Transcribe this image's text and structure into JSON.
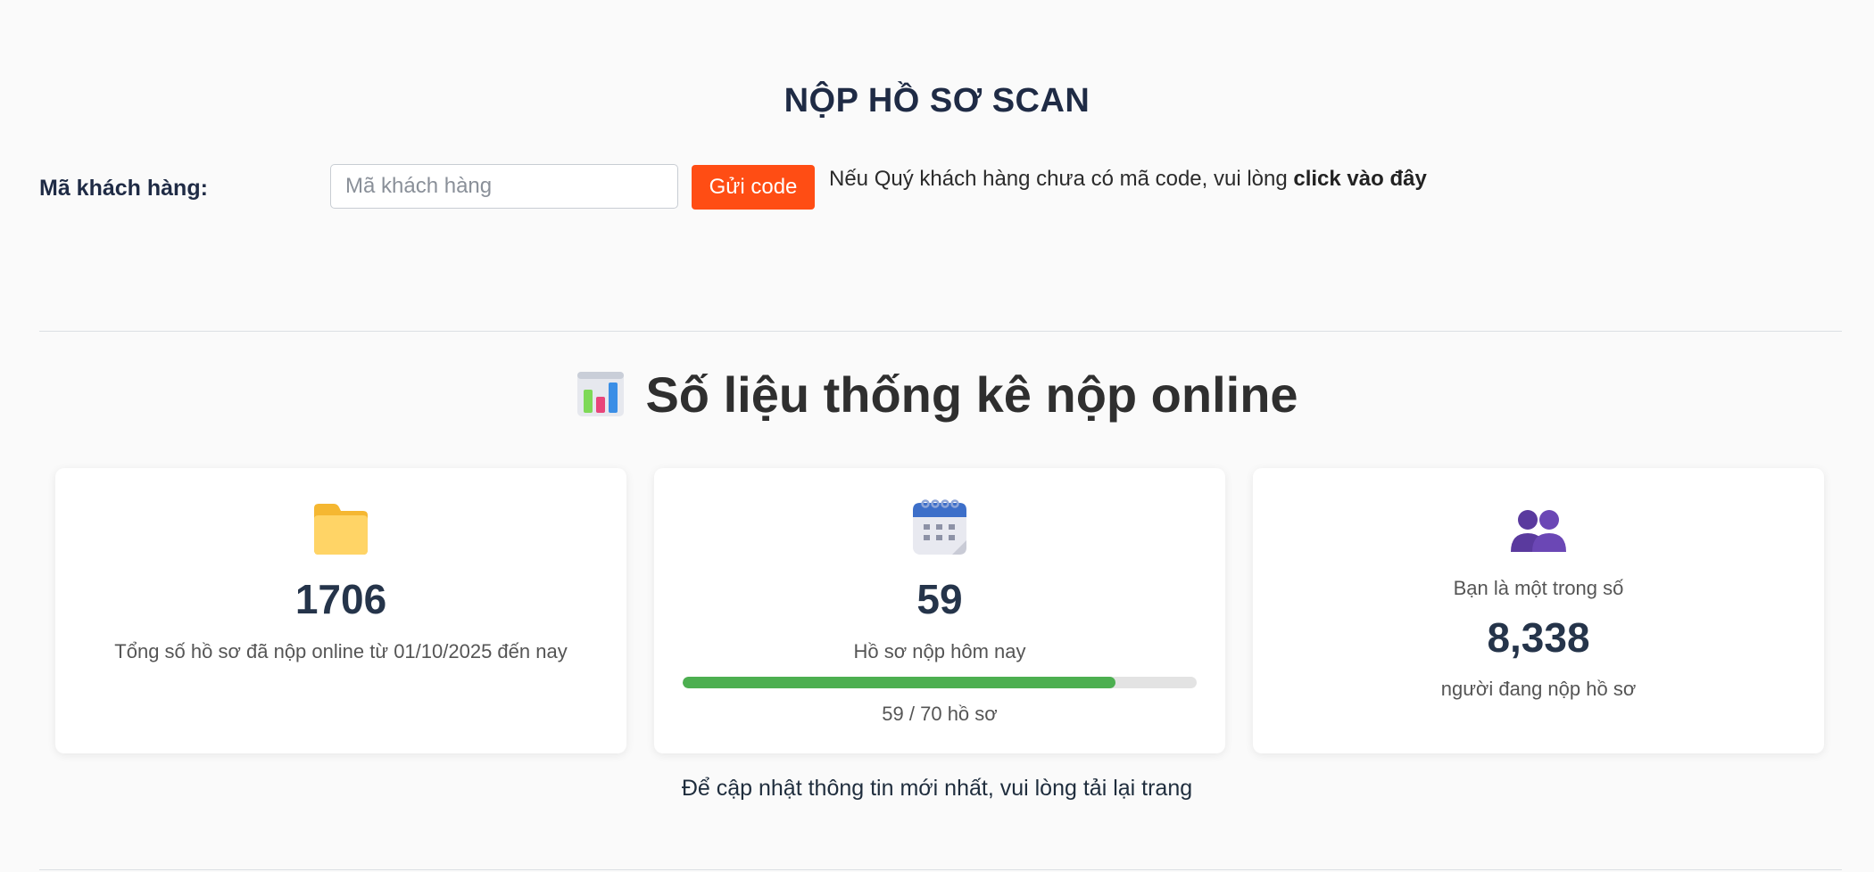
{
  "header": {
    "title": "NỘP HỒ SƠ SCAN"
  },
  "form": {
    "customer_label": "Mã khách hàng:",
    "customer_input": {
      "value": "",
      "placeholder": "Mã khách hàng"
    },
    "send_button": "Gửi code",
    "note_text": "Nếu Quý khách hàng chưa có mã code, vui lòng ",
    "note_link": "click vào đây"
  },
  "stats": {
    "heading": "Số liệu thống kê nộp online",
    "heading_icon": "bar-chart-icon",
    "cards": [
      {
        "icon": "folder-icon",
        "value": "1706",
        "caption": "Tổng số hồ sơ đã nộp online từ 01/10/2025 đến nay"
      },
      {
        "icon": "calendar-icon",
        "value": "59",
        "caption": "Hồ sơ nộp hôm nay",
        "progress": {
          "current": 59,
          "total": 70,
          "text": "59 / 70 hồ sơ"
        }
      },
      {
        "icon": "people-icon",
        "pre_caption": "Bạn là một trong số",
        "value": "8,338",
        "caption": "người đang nộp hồ sơ"
      }
    ],
    "footer_note": "Để cập nhật thông tin mới nhất, vui lòng tải lại trang"
  },
  "colors": {
    "accent_button": "#ff4d14",
    "progress_fill": "#4caf50",
    "title": "#1f2b45"
  }
}
